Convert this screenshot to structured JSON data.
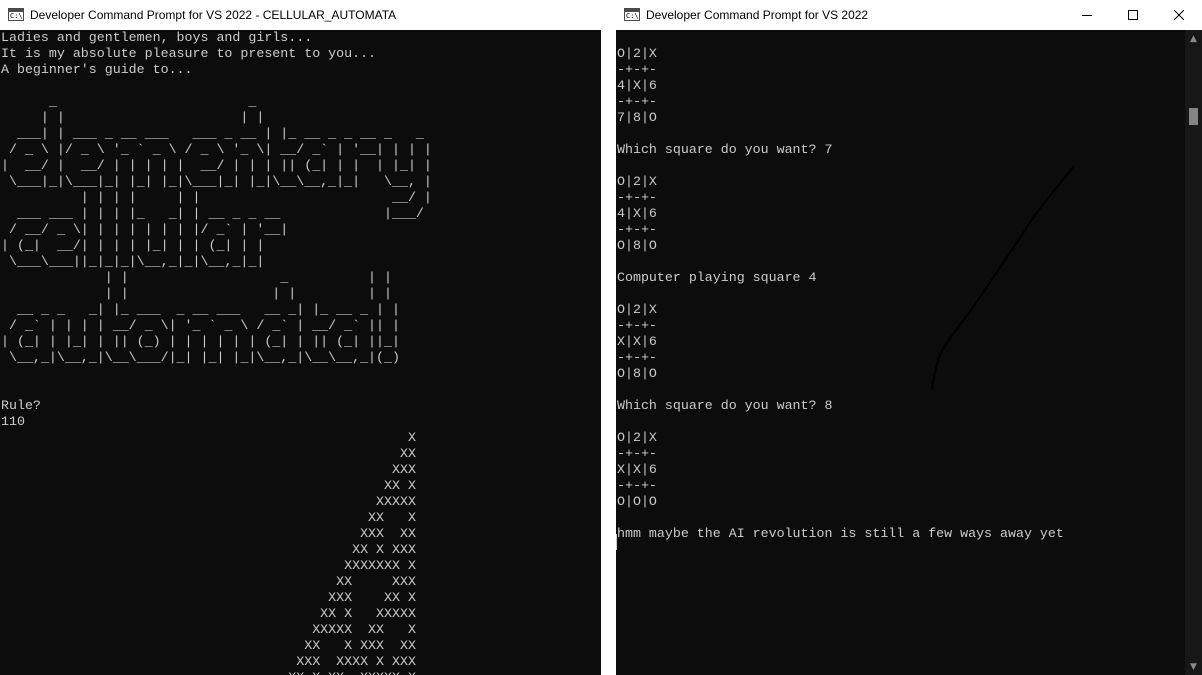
{
  "left_window": {
    "title": "Developer Command Prompt for VS 2022 - CELLULAR_AUTOMATA",
    "output": "Ladies and gentlemen, boys and girls...\nIt is my absolute pleasure to present to you...\nA beginner's guide to...\n\n      _                        _\n     | |                      | |\n  ___| | ___ _ __ ___   ___ _ __ | |_ __ _ _ __ _   _\n / _ \\ |/ _ \\ '_ ` _ \\ / _ \\ '_ \\| __/ _` | '__| | | |\n|  __/ |  __/ | | | | |  __/ | | | || (_| | |  | |_| |\n \\___|_|\\___|_| |_| |_|\\___|_| |_|\\__\\__,_|_|   \\__, |\n          | | | |     | |                        __/ |\n  ___ ___ | | | |_   _| | __ _ _ __             |___/\n / __/ _ \\| | | | | | | |/ _` | '__|\n| (_|  __/| | | | |_| | | (_| | |\n \\___\\___||_|_|_|\\__,_|_|\\__,_|_|\n             | |                   _          | |\n             | |                  | |         | |\n  __ _ _   _| |_ ___  _ __ ___   __ _| |_ __ _ | |\n / _` | | | | __/ _ \\| '_ ` _ \\ / _` | __/ _` || |\n| (_| | |_| | || (_) | | | | | | (_| | || (_| ||_|\n \\__,_|\\__,_|\\__\\___/|_| |_| |_|\\__,_|\\__\\__,_|(_)\n\n\nRule?\n110\n                                                   X\n                                                  XX\n                                                 XXX\n                                                XX X\n                                               XXXXX\n                                              XX   X\n                                             XXX  XX\n                                            XX X XXX\n                                           XXXXXXX X\n                                          XX     XXX\n                                         XXX    XX X\n                                        XX X   XXXXX\n                                       XXXXX  XX   X\n                                      XX   X XXX  XX\n                                     XXX  XXXX X XXX\n                                    XX X XX  XXXXX X"
  },
  "right_window": {
    "title": "Developer Command Prompt for VS 2022",
    "output": "O|2|X\n-+-+-\n4|X|6\n-+-+-\n7|8|O\n\nWhich square do you want? 7\n\nO|2|X\n-+-+-\n4|X|6\n-+-+-\nO|8|O\n\nComputer playing square 4\n\nO|2|X\n-+-+-\nX|X|6\n-+-+-\nO|8|O\n\nWhich square do you want? 8\n\nO|2|X\n-+-+-\nX|X|6\n-+-+-\nO|O|O\n\nhmm maybe the AI revolution is still a few ways away yet"
  },
  "icons": {
    "console": "console-app-icon",
    "minimize": "minimize-icon",
    "maximize": "maximize-icon",
    "close": "close-icon",
    "scroll_up": "scroll-up-arrow-icon",
    "scroll_down": "scroll-down-arrow-icon"
  },
  "colors": {
    "terminal_background": "#0c0c0c",
    "terminal_text": "#cccccc",
    "titlebar": "#ffffff"
  }
}
